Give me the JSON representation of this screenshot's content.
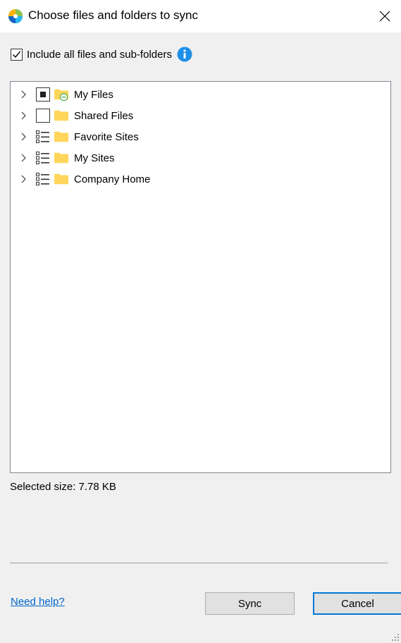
{
  "window": {
    "title": "Choose files and folders to sync",
    "icons": {
      "app": "sync-app-logo-icon",
      "close": "close-icon"
    }
  },
  "options": {
    "include_all_label": "Include all files and sub-folders",
    "include_all_checked": true,
    "info_icon": "info-icon"
  },
  "tree": {
    "items": [
      {
        "label": "My Files",
        "check_state": "partial",
        "folder_icon": "folder-with-sync-status-icon"
      },
      {
        "label": "Shared Files",
        "check_state": "unchecked",
        "folder_icon": "folder-icon"
      },
      {
        "label": "Favorite Sites",
        "check_state": "list",
        "folder_icon": "folder-icon"
      },
      {
        "label": "My Sites",
        "check_state": "list",
        "folder_icon": "folder-icon"
      },
      {
        "label": "Company Home",
        "check_state": "list",
        "folder_icon": "folder-icon"
      }
    ]
  },
  "status": {
    "selected_size": "Selected size: 7.78 KB"
  },
  "footer": {
    "help_link": "Need help?",
    "sync_label": "Sync",
    "cancel_label": "Cancel"
  },
  "colors": {
    "link": "#0066cc",
    "folder": "#ffd65a",
    "info": "#1e90e8",
    "focus_border": "#0078d7"
  }
}
